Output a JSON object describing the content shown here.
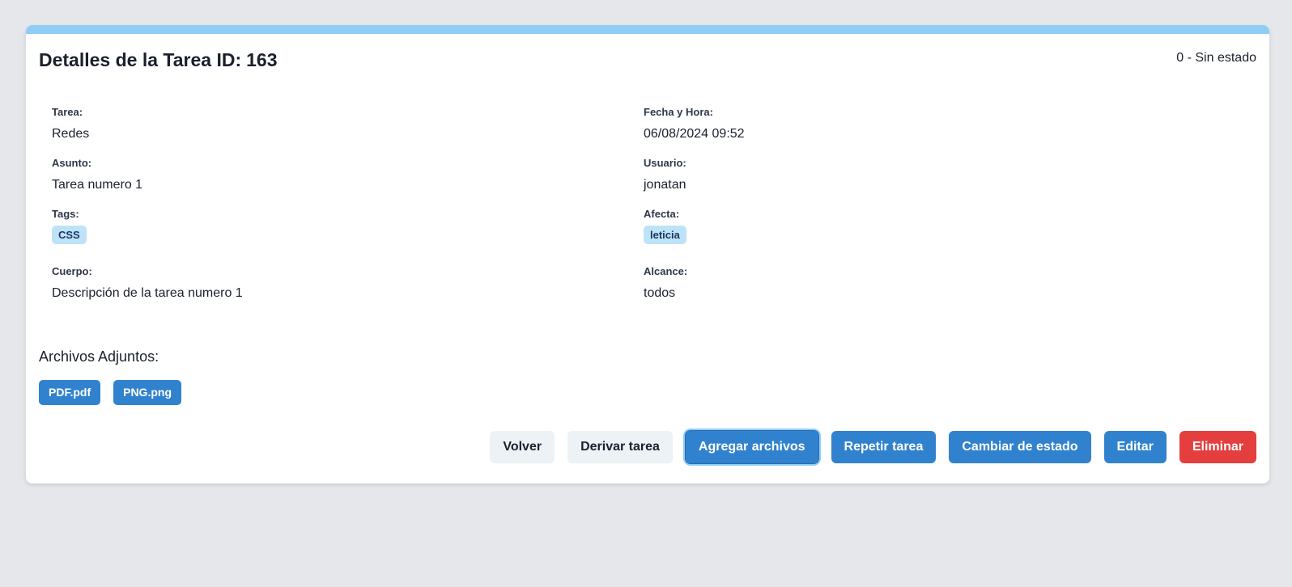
{
  "header": {
    "title_prefix": "Detalles de la Tarea ID:",
    "task_id": "163",
    "status": "0 - Sin estado"
  },
  "fields": {
    "tarea": {
      "label": "Tarea:",
      "value": "Redes"
    },
    "fecha_hora": {
      "label": "Fecha y Hora:",
      "value": "06/08/2024 09:52"
    },
    "asunto": {
      "label": "Asunto:",
      "value": "Tarea numero 1"
    },
    "usuario": {
      "label": "Usuario:",
      "value": "jonatan"
    },
    "tags": {
      "label": "Tags:",
      "items": [
        "CSS"
      ]
    },
    "afecta": {
      "label": "Afecta:",
      "items": [
        "leticia"
      ]
    },
    "cuerpo": {
      "label": "Cuerpo:",
      "value": "Descripción de la tarea numero 1"
    },
    "alcance": {
      "label": "Alcance:",
      "value": "todos"
    }
  },
  "attachments": {
    "title": "Archivos Adjuntos:",
    "files": [
      "PDF.pdf",
      "PNG.png"
    ]
  },
  "actions": {
    "volver": "Volver",
    "derivar": "Derivar tarea",
    "agregar_archivos": "Agregar archivos",
    "repetir": "Repetir tarea",
    "cambiar_estado": "Cambiar de estado",
    "editar": "Editar",
    "eliminar": "Eliminar"
  },
  "colors": {
    "background": "#e5e7eb",
    "card_top_bar": "#90cdf4",
    "primary": "#3182ce",
    "danger": "#e53e3e",
    "light_button": "#edf2f7",
    "tag_background": "#bee3f8"
  }
}
